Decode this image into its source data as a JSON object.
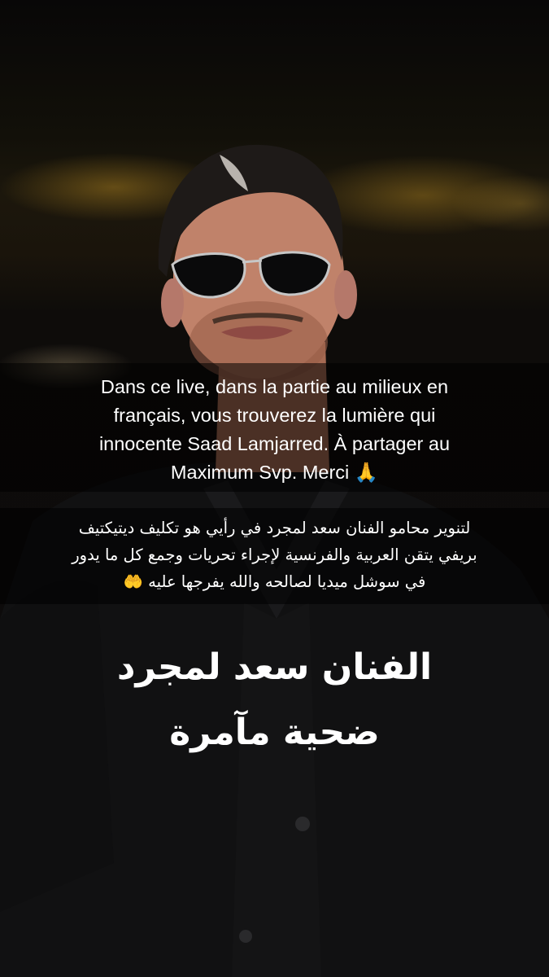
{
  "photo": {
    "subject": "man-wearing-sunglasses-and-black-suit"
  },
  "captions": {
    "french_line_1": "Dans ce live, dans la partie au milieux en",
    "french_line_2": "français, vous trouverez la lumière qui",
    "french_line_3": "innocente Saad Lamjarred. À partager au",
    "french_line_4": "Maximum Svp.  Merci 🙏",
    "arabic_line_1": "لتنوير محامو الفنان سعد لمجرد في رأيي هو تكليف ديتيكتيف",
    "arabic_line_2": "بريفي يتقن العربية والفرنسية لإجراء تحريات وجمع كل ما يدور",
    "arabic_line_3": "في سوشل ميديا لصالحه والله يفرجها عليه 🤲"
  },
  "headline": {
    "line_1": "الفنان سعد لمجرد",
    "line_2": "ضحية مآمرة"
  },
  "colors": {
    "caption_bg": "#000000",
    "text": "#ffffff",
    "bokeh_gold": "#a07a20"
  }
}
